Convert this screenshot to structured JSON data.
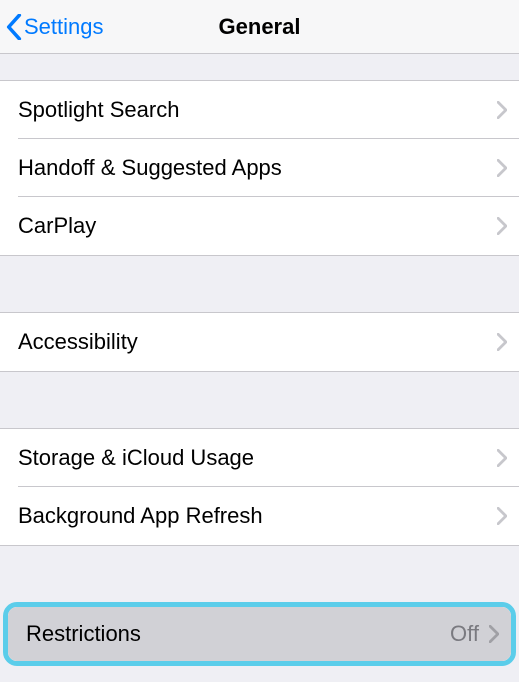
{
  "nav": {
    "back_label": "Settings",
    "title": "General"
  },
  "groups": [
    {
      "items": [
        {
          "label": "Spotlight Search"
        },
        {
          "label": "Handoff & Suggested Apps"
        },
        {
          "label": "CarPlay"
        }
      ]
    },
    {
      "items": [
        {
          "label": "Accessibility"
        }
      ]
    },
    {
      "items": [
        {
          "label": "Storage & iCloud Usage"
        },
        {
          "label": "Background App Refresh"
        }
      ]
    },
    {
      "highlighted": true,
      "items": [
        {
          "label": "Restrictions",
          "value": "Off"
        }
      ]
    }
  ]
}
